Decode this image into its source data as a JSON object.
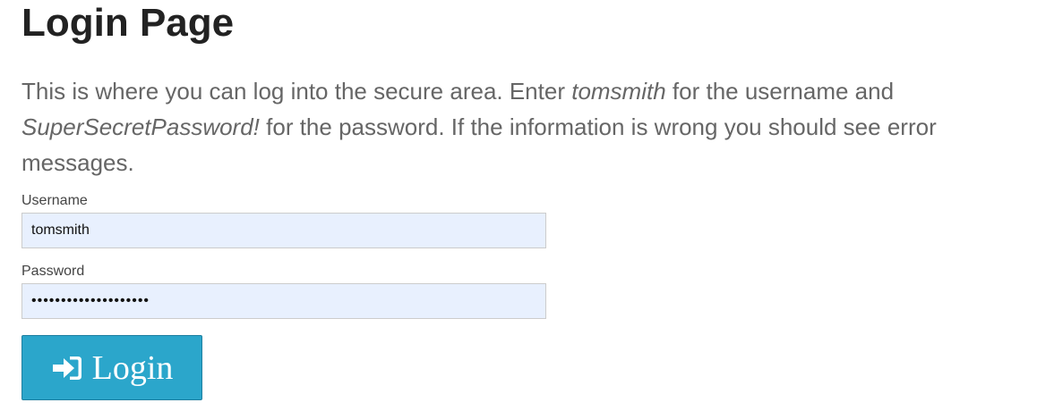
{
  "page": {
    "title": "Login Page",
    "subheader": {
      "part1": "This is where you can log into the secure area. Enter ",
      "username_hint": "tomsmith",
      "part2": " for the username and ",
      "password_hint": "SuperSecretPassword!",
      "part3": " for the password. If the information is wrong you should see error messages."
    }
  },
  "form": {
    "username": {
      "label": "Username",
      "value": "tomsmith"
    },
    "password": {
      "label": "Password",
      "value": "SuperSecretPassword!"
    },
    "submit": {
      "label": "Login",
      "icon": "sign-in-icon"
    }
  },
  "colors": {
    "button": "#2ba6cb",
    "input_autofill_bg": "#e8f0fe",
    "text_muted": "#666666"
  }
}
